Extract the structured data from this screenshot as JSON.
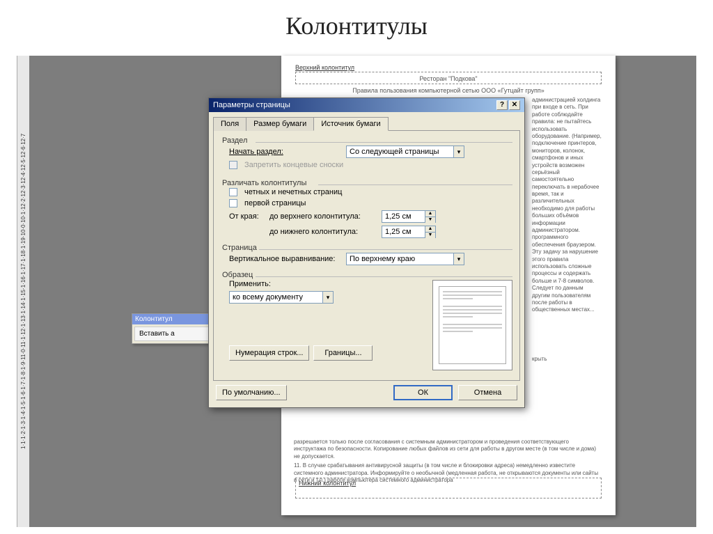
{
  "slide_title": "Колонтитулы",
  "ruler_marks": "1·1·1·2·1·3·1·4·1·5·1·6·1·7·1·8·1·9·11·0·11·1·12·1·13·1·14·1·15·1·16·1·17·1·18·1·19·10·0·10·1·12·2·12·3·12·4·12·5·12·6·12·7",
  "doc": {
    "header_label": "Верхний колонтитул",
    "restaurant": "Ресторан \"Подкова\"",
    "subtitle": "Правила пользования компьютерной сетью ООО «Гутцайт групп»",
    "footer_label": "Нижний колонтитул",
    "body_text": "администрацией холдинга при входе в сеть. При работе соблюдайте правила: не пытайтесь использовать оборудование. (Например, подключение принтеров, мониторов, колонок, смартфонов и иных устройств возможен серьёзный самостоятельно переключать в нерабочее время, так и различительных необходимо для работы больших объёмов информации администратором. программного обеспечения браузером. Эту задачу за нарушение этого правила использовать сложные процессы и содержать больше и 7-8 символов. Следует по данным другим пользователям после работы в общественных местах...",
    "bottom_text_1": "разрешается только после согласования с системным администратором и проведения соответствующего инструктажа по безопасности. Копирование любых файлов из сети для работы в другом месте (в том числе и дома) не допускается.",
    "bottom_text_2": "В случае срабатывания антивирусной защиты (в том числе и блокировки адреса) немедленно известите системного администратора. Информируйте о необычной (медленная работа, не открываются документы или сайты в сети и т.п.) работе компьютера системного администратора"
  },
  "toolbar": {
    "title": "Колонтитул",
    "btn_insert": "Вставить а",
    "btn_close": "крыть"
  },
  "dialog": {
    "title": "Параметры страницы",
    "tabs": {
      "fields": "Поля",
      "paper_size": "Размер бумаги",
      "paper_source": "Источник бумаги"
    },
    "section": {
      "legend": "Раздел",
      "start_label": "Начать раздел:",
      "start_value": "Со следующей страницы",
      "suppress_endnotes": "Запретить концевые сноски"
    },
    "headers": {
      "legend": "Различать колонтитулы",
      "odd_even": "четных и нечетных страниц",
      "first_page": "первой страницы",
      "from_edge": "От края:",
      "to_header": "до верхнего колонтитула:",
      "to_footer": "до нижнего колонтитула:",
      "header_val": "1,25 см",
      "footer_val": "1,25 см"
    },
    "page": {
      "legend": "Страница",
      "valign_label": "Вертикальное выравнивание:",
      "valign_value": "По верхнему краю"
    },
    "preview": {
      "legend": "Образец",
      "apply_label": "Применить:",
      "apply_value": "ко всему документу"
    },
    "buttons": {
      "line_numbers": "Нумерация строк...",
      "borders": "Границы...",
      "default": "По умолчанию...",
      "ok": "ОК",
      "cancel": "Отмена"
    }
  }
}
